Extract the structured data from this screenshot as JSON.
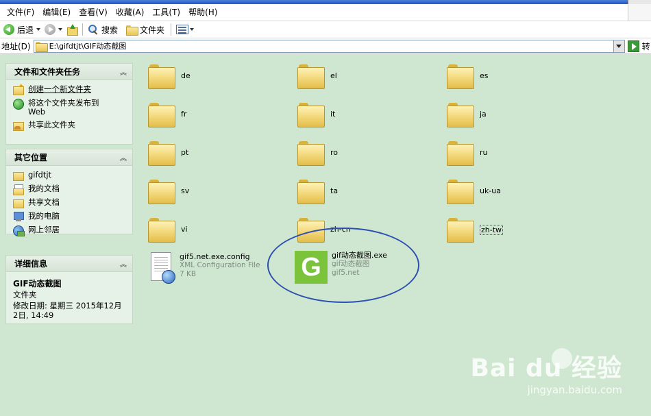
{
  "menubar": {
    "items": [
      "文件(F)",
      "编辑(E)",
      "查看(V)",
      "收藏(A)",
      "工具(T)",
      "帮助(H)"
    ]
  },
  "toolbar": {
    "back_label": "后退",
    "search_label": "搜索",
    "folders_label": "文件夹"
  },
  "address": {
    "label": "地址(D)",
    "path": "E:\\gifdtjt\\GIF动态截图",
    "go_label": "转"
  },
  "tasks_panel": {
    "title": "文件和文件夹任务",
    "items": [
      {
        "label": "创建一个新文件夹",
        "icon": "new-folder-icon"
      },
      {
        "label": "将这个文件夹发布到",
        "label2": "Web",
        "icon": "web-publish-icon"
      },
      {
        "label": "共享此文件夹",
        "icon": "share-folder-icon"
      }
    ]
  },
  "places_panel": {
    "title": "其它位置",
    "items": [
      {
        "label": "gifdtjt",
        "icon": "folder-icon"
      },
      {
        "label": "我的文档",
        "icon": "my-documents-icon"
      },
      {
        "label": "共享文档",
        "icon": "shared-documents-icon"
      },
      {
        "label": "我的电脑",
        "icon": "my-computer-icon"
      },
      {
        "label": "网上邻居",
        "icon": "network-places-icon"
      }
    ]
  },
  "details_panel": {
    "title": "详细信息",
    "name": "GIF动态截图",
    "type": "文件夹",
    "modified_line1": "修改日期: 星期三 2015年12月",
    "modified_line2": "2日, 14:49"
  },
  "folders": [
    "de",
    "el",
    "es",
    "fr",
    "it",
    "ja",
    "pt",
    "ro",
    "ru",
    "sv",
    "ta",
    "uk-ua",
    "vi",
    "zh-cn",
    "zh-tw"
  ],
  "files": [
    {
      "name": "gif5.net.exe.config",
      "desc1": "XML Configuration File",
      "desc2": "7 KB",
      "icon": "xml-config-icon"
    },
    {
      "name": "gif动态截图.exe",
      "desc1": "gif动态截图",
      "desc2": "gif5.net",
      "icon": "gif-app-icon"
    }
  ],
  "watermark": {
    "main": "Bai du 经验",
    "sub": "jingyan.baidu.com"
  },
  "colors": {
    "background": "#cfe7d0",
    "highlight_ellipse": "#2c4fb0",
    "app_icon_green": "#7cc33c"
  }
}
